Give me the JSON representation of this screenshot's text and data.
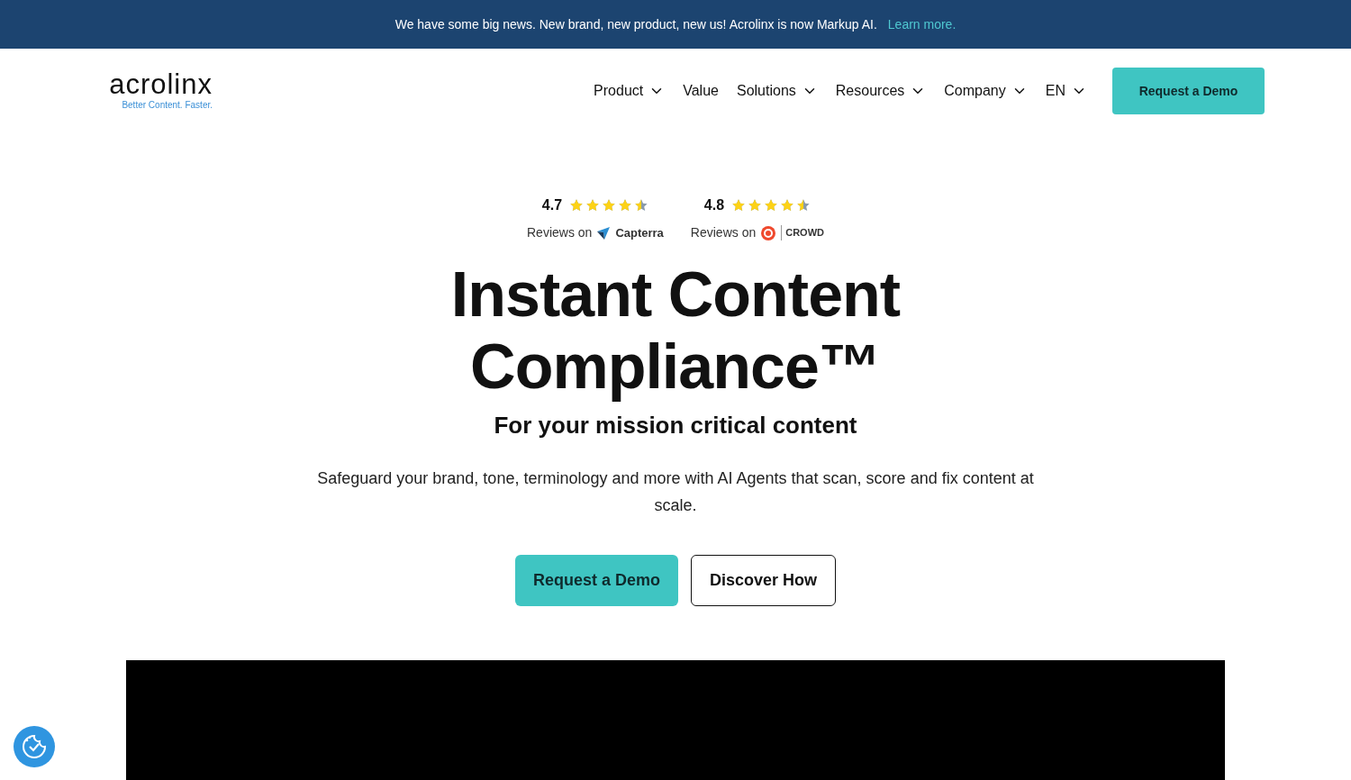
{
  "banner": {
    "text": "We have some big news. New brand, new product, new us! Acrolinx is now Markup AI.",
    "link": "Learn more."
  },
  "logo": {
    "wordmark": "acrolinx",
    "tagline": "Better Content. Faster."
  },
  "nav": {
    "items": [
      {
        "label": "Product",
        "dropdown": true
      },
      {
        "label": "Value",
        "dropdown": false
      },
      {
        "label": "Solutions",
        "dropdown": true
      },
      {
        "label": "Resources",
        "dropdown": true
      },
      {
        "label": "Company",
        "dropdown": true
      },
      {
        "label": "EN",
        "dropdown": true
      }
    ],
    "cta": "Request a Demo"
  },
  "ratings": [
    {
      "score": "4.7",
      "stars": 4.5,
      "prefix": "Reviews on",
      "brand": "Capterra",
      "kind": "capterra"
    },
    {
      "score": "4.8",
      "stars": 4.5,
      "prefix": "Reviews on",
      "brand": "CROWD",
      "kind": "g2"
    }
  ],
  "hero": {
    "title_lines": [
      "Instant Content",
      "Compliance™"
    ],
    "subtitle": "For your mission critical content",
    "body": "Safeguard your brand, tone, terminology and more with AI Agents that scan, score and fix content at scale.",
    "primary": "Request a Demo",
    "secondary": "Discover How"
  }
}
